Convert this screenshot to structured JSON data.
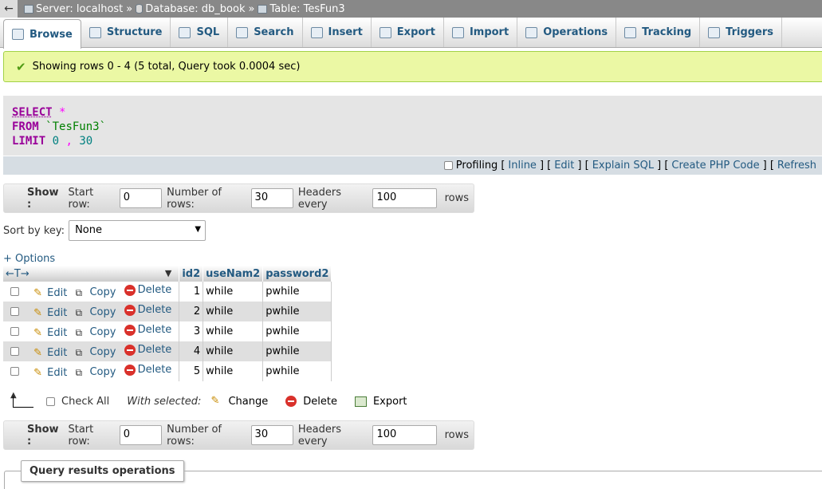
{
  "breadcrumb": {
    "server": "Server: localhost",
    "database": "Database: db_book",
    "table": "Table: TesFun3",
    "sep": "»"
  },
  "tabs": [
    {
      "label": "Browse",
      "icon": "browse-icon"
    },
    {
      "label": "Structure",
      "icon": "structure-icon"
    },
    {
      "label": "SQL",
      "icon": "sql-icon"
    },
    {
      "label": "Search",
      "icon": "search-icon"
    },
    {
      "label": "Insert",
      "icon": "insert-icon"
    },
    {
      "label": "Export",
      "icon": "export-icon"
    },
    {
      "label": "Import",
      "icon": "import-icon"
    },
    {
      "label": "Operations",
      "icon": "wrench-icon"
    },
    {
      "label": "Tracking",
      "icon": "eye-icon"
    },
    {
      "label": "Triggers",
      "icon": "triggers-icon"
    }
  ],
  "message": "Showing rows 0 - 4 (5 total, Query took 0.0004 sec)",
  "sql": {
    "select": "SELECT",
    "star": "*",
    "from": "FROM",
    "table": "`TesFun3`",
    "limit": "LIMIT",
    "offset": "0",
    "comma": ",",
    "count": "30"
  },
  "sql_options": {
    "profiling": "Profiling",
    "inline": "Inline",
    "edit": "Edit",
    "explain": "Explain SQL",
    "php": "Create PHP Code",
    "refresh": "Refresh"
  },
  "nav": {
    "show": "Show :",
    "start_row": "Start row:",
    "start_value": "0",
    "num_rows": "Number of rows:",
    "num_value": "30",
    "headers_every": "Headers every",
    "headers_value": "100",
    "rows": "rows"
  },
  "sort": {
    "label": "Sort by key:",
    "value": "None"
  },
  "options_link": "+ Options",
  "table": {
    "arrows": "←T→",
    "columns": [
      "id2",
      "useNam2",
      "password2"
    ],
    "actions": {
      "edit": "Edit",
      "copy": "Copy",
      "delete": "Delete"
    },
    "rows": [
      {
        "id2": "1",
        "useNam2": "while",
        "password2": "pwhile"
      },
      {
        "id2": "2",
        "useNam2": "while",
        "password2": "pwhile"
      },
      {
        "id2": "3",
        "useNam2": "while",
        "password2": "pwhile"
      },
      {
        "id2": "4",
        "useNam2": "while",
        "password2": "pwhile"
      },
      {
        "id2": "5",
        "useNam2": "while",
        "password2": "pwhile"
      }
    ]
  },
  "bulk": {
    "check_all": "Check All",
    "with_selected": "With selected:",
    "change": "Change",
    "delete": "Delete",
    "export": "Export"
  },
  "query_results_ops": "Query results operations"
}
